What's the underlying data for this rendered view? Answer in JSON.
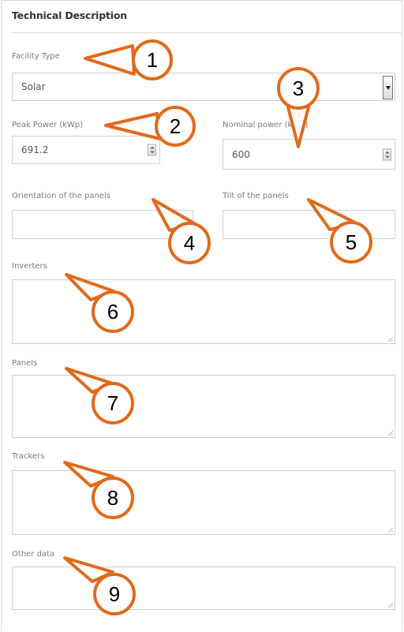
{
  "section": {
    "title": "Technical Description"
  },
  "facility_type": {
    "label": "Facility Type",
    "value": "Solar"
  },
  "peak_power": {
    "label": "Peak Power (kWp)",
    "value": "691.2"
  },
  "nominal_power": {
    "label": "Nominal power (kWn)",
    "value": "600"
  },
  "orientation": {
    "label": "Orientation of the panels",
    "value": ""
  },
  "tilt": {
    "label": "Tilt of the panels",
    "value": ""
  },
  "inverters": {
    "label": "Inverters",
    "value": ""
  },
  "panels": {
    "label": "Panels",
    "value": ""
  },
  "trackers": {
    "label": "Trackers",
    "value": ""
  },
  "other_data": {
    "label": "Other data",
    "value": ""
  },
  "callouts": [
    "1",
    "2",
    "3",
    "4",
    "5",
    "6",
    "7",
    "8",
    "9"
  ],
  "colors": {
    "callout": "#e06a1b",
    "border": "#cfcfcf",
    "label": "#7a7a7a"
  }
}
